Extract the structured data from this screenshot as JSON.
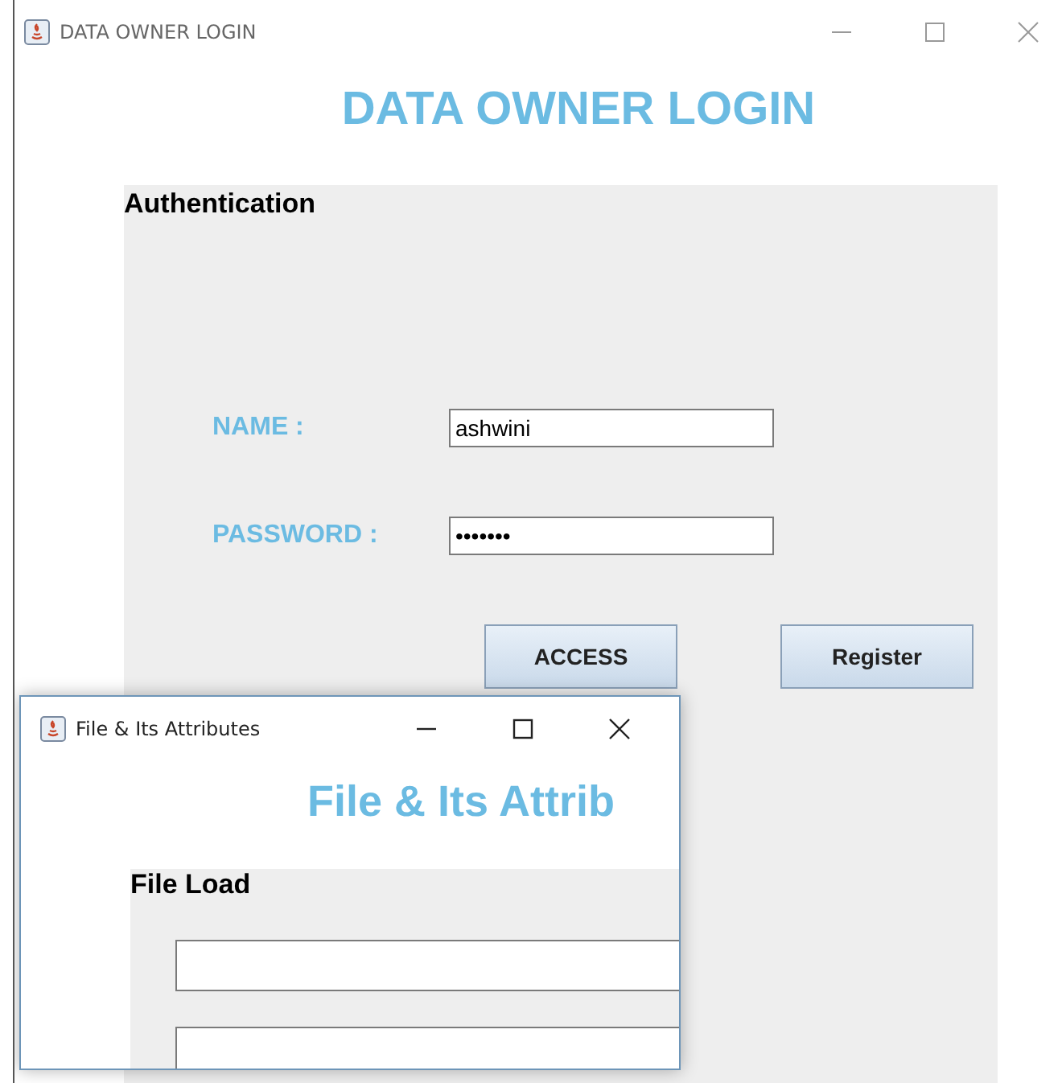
{
  "window": {
    "title": "DATA OWNER LOGIN"
  },
  "heading": "DATA OWNER LOGIN",
  "panel": {
    "title": "Authentication",
    "fields": [
      {
        "label": "NAME :",
        "value": "ashwini"
      },
      {
        "label": "PASSWORD :",
        "value": "•••••••"
      }
    ],
    "buttons": [
      "ACCESS",
      "Register"
    ]
  },
  "dialog": {
    "title": "File & Its Attributes",
    "heading": "File & Its Attrib",
    "panel_title": "File Load",
    "fields": [
      {
        "kind": "text_field"
      },
      {
        "kind": "text_field"
      }
    ]
  }
}
